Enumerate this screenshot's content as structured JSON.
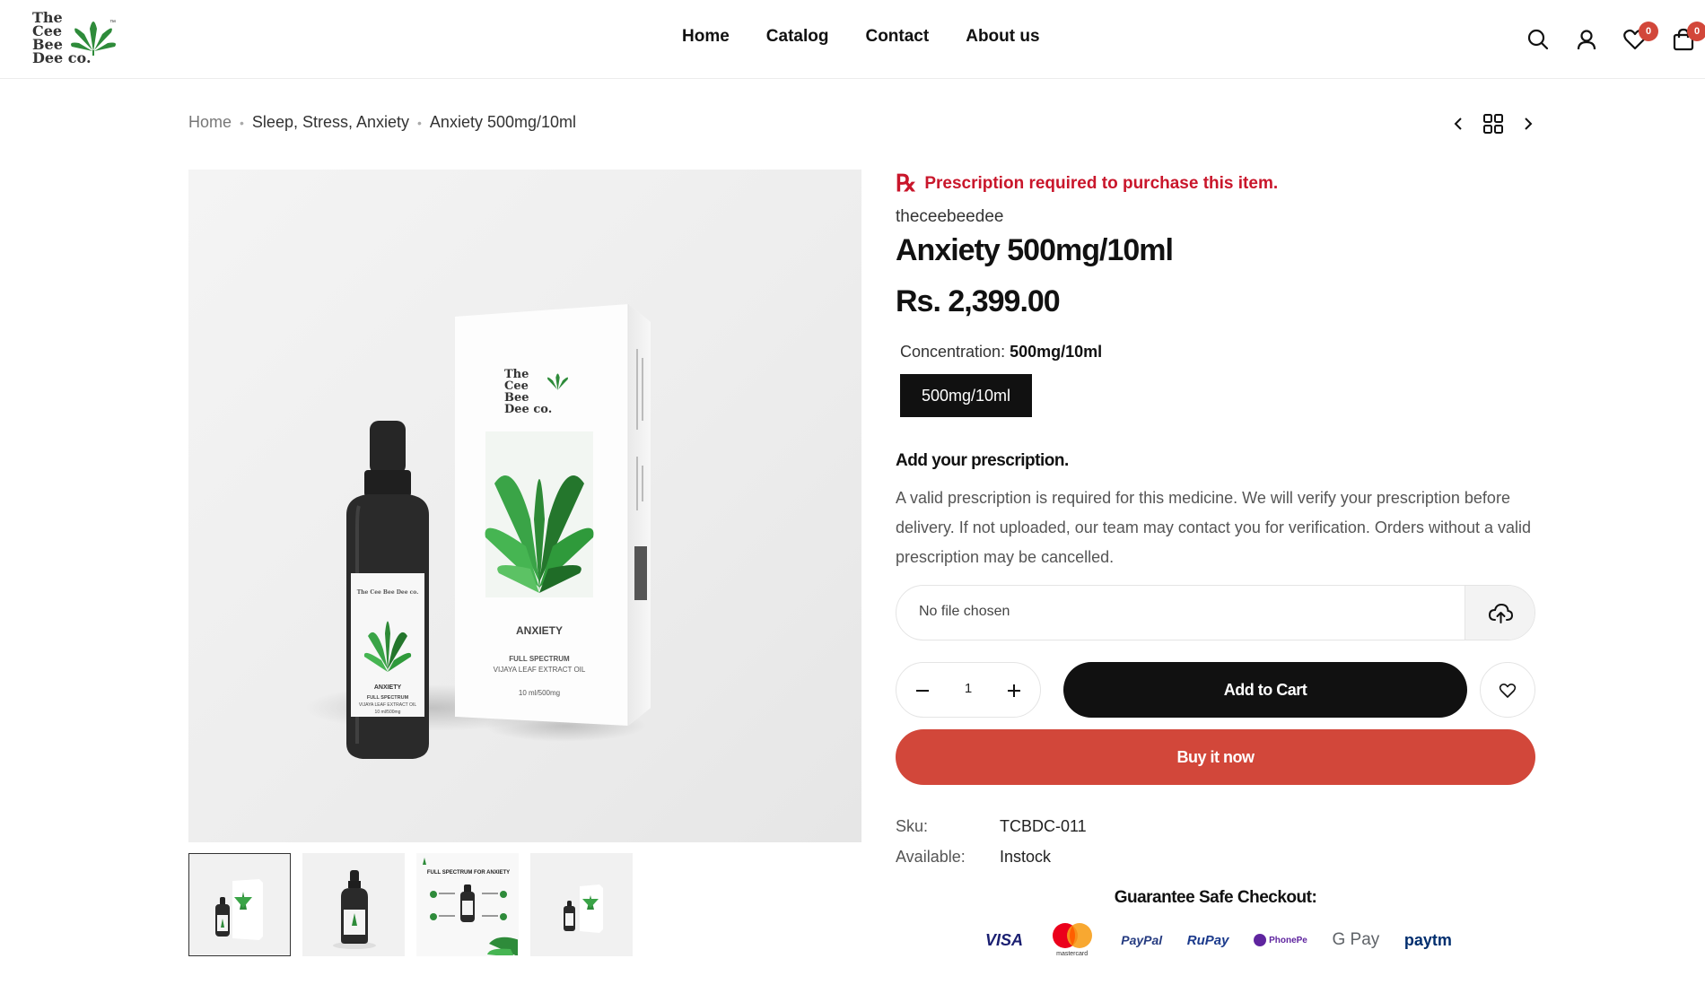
{
  "header": {
    "logo_lines": [
      "The",
      "Cee",
      "Bee",
      "Dee co."
    ],
    "logo_tm": "™",
    "nav": [
      "Home",
      "Catalog",
      "Contact",
      "About us"
    ],
    "wishlist_count": "0",
    "cart_count": "0"
  },
  "breadcrumb": {
    "home": "Home",
    "category": "Sleep, Stress, Anxiety",
    "current": "Anxiety 500mg/10ml"
  },
  "product": {
    "rx_symbol": "℞",
    "rx_notice": "Prescription required to purchase this item.",
    "vendor": "theceebeedee",
    "title": "Anxiety 500mg/10ml",
    "price": "Rs. 2,399.00",
    "variant_label": "Concentration:",
    "variant_selected": "500mg/10ml",
    "variant_option": "500mg/10ml",
    "rx_heading": "Add your prescription.",
    "rx_description": "A valid prescription is required for this medicine. We will verify your prescription before delivery. If not uploaded, our team may contact you for verification. Orders without a valid prescription may be cancelled.",
    "file_status": "No file chosen",
    "quantity": "1",
    "add_to_cart": "Add to Cart",
    "buy_now": "Buy it now",
    "sku_label": "Sku:",
    "sku_value": "TCBDC-011",
    "available_label": "Available:",
    "available_value": "Instock",
    "guarantee": "Guarantee Safe Checkout:"
  },
  "image_text": {
    "box_name": "ANXIETY",
    "box_line1": "FULL SPECTRUM",
    "box_line2": "VIJAYA LEAF EXTRACT OIL",
    "box_volume": "10 ml/500mg",
    "bottle_name": "ANXIETY",
    "bottle_line1": "FULL SPECTRUM",
    "bottle_line2": "VIJAYA LEAF EXTRACT OIL",
    "bottle_volume": "10 ml/500mg",
    "thumb3_title": "FULL SPECTRUM FOR ANXIETY"
  },
  "payments": [
    "VISA",
    "mastercard",
    "PayPal",
    "RuPay",
    "PhonePe",
    "G Pay",
    "paytm"
  ],
  "colors": {
    "accent_red": "#d2473a",
    "rx_red": "#c9162b",
    "leaf_green": "#2e8b3a",
    "dark": "#111111"
  }
}
